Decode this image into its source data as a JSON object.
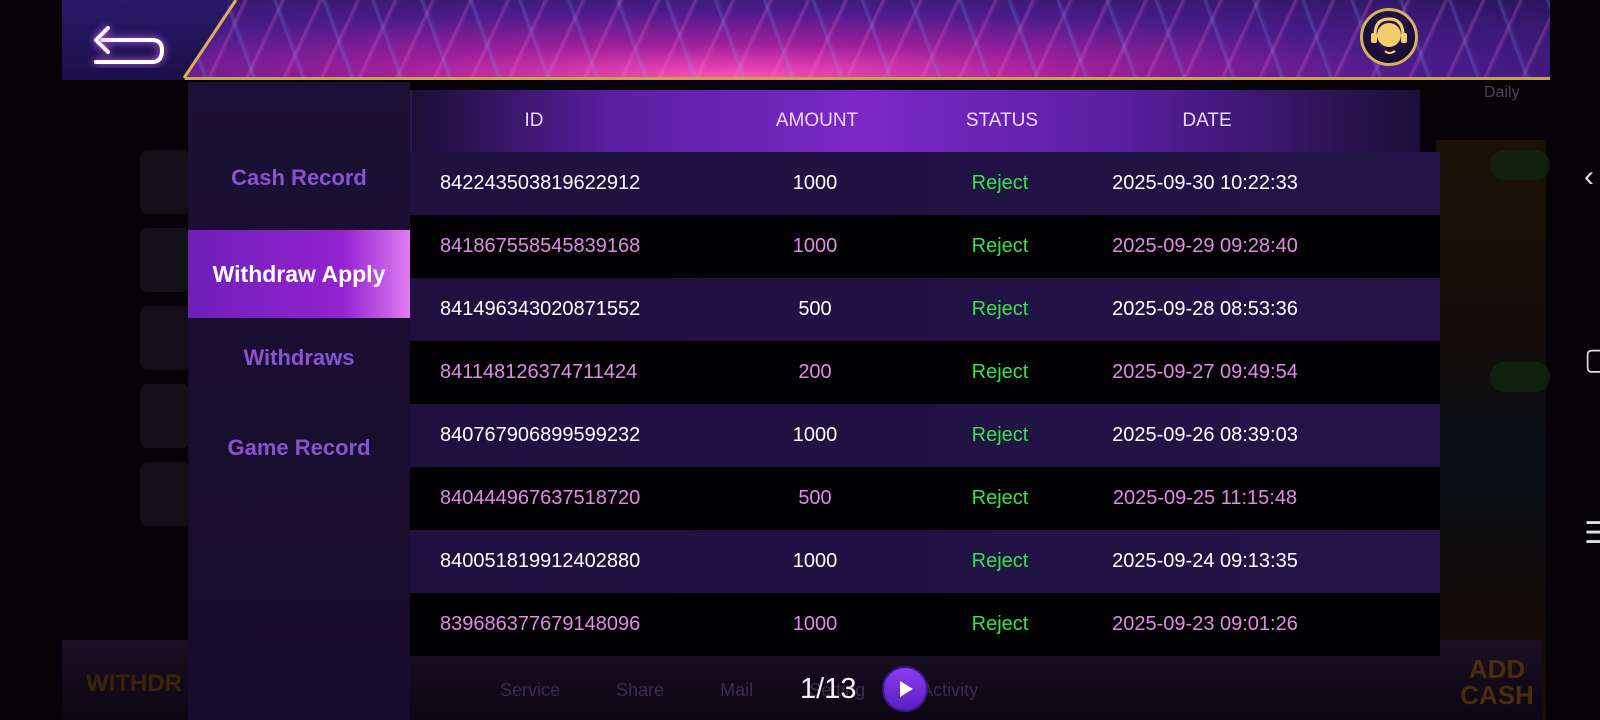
{
  "header": {
    "back_icon": "back-arrow-icon",
    "support_icon": "customer-support-icon"
  },
  "background": {
    "daily_label": "Daily",
    "bottom_labels": [
      "Service",
      "Share",
      "Mail",
      "Setting",
      "Activity"
    ],
    "withdraw_label": "WITHDR",
    "add_cash_label": "ADD CASH"
  },
  "sidebar": {
    "items": [
      {
        "label": "Cash Record",
        "active": false
      },
      {
        "label": "Withdraw Apply",
        "active": true
      },
      {
        "label": "Withdraws",
        "active": false
      },
      {
        "label": "Game Record",
        "active": false
      }
    ]
  },
  "table": {
    "columns": [
      "ID",
      "AMOUNT",
      "STATUS",
      "DATE"
    ],
    "rows": [
      {
        "id": "842243503819622912",
        "amount": "1000",
        "status": "Reject",
        "date": "2025-09-30 10:22:33"
      },
      {
        "id": "841867558545839168",
        "amount": "1000",
        "status": "Reject",
        "date": "2025-09-29 09:28:40"
      },
      {
        "id": "841496343020871552",
        "amount": "500",
        "status": "Reject",
        "date": "2025-09-28 08:53:36"
      },
      {
        "id": "841148126374711424",
        "amount": "200",
        "status": "Reject",
        "date": "2025-09-27 09:49:54"
      },
      {
        "id": "840767906899599232",
        "amount": "1000",
        "status": "Reject",
        "date": "2025-09-26 08:39:03"
      },
      {
        "id": "840444967637518720",
        "amount": "500",
        "status": "Reject",
        "date": "2025-09-25 11:15:48"
      },
      {
        "id": "840051819912402880",
        "amount": "1000",
        "status": "Reject",
        "date": "2025-09-24 09:13:35"
      },
      {
        "id": "839686377679148096",
        "amount": "1000",
        "status": "Reject",
        "date": "2025-09-23 09:01:26"
      }
    ]
  },
  "pager": {
    "label": "1/13",
    "next_icon": "play-next-icon"
  },
  "colors": {
    "status_reject": "#36e34a",
    "active_tab": "#9323d0",
    "inactive_tab_text": "#8a52cf",
    "even_row_text": "#e28ae6"
  }
}
